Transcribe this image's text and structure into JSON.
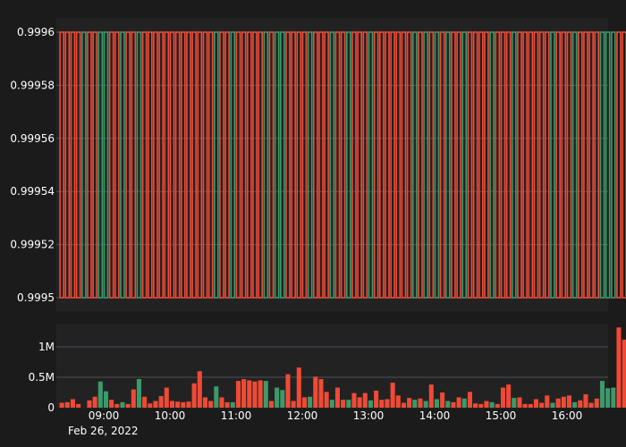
{
  "chart_data": [
    {
      "panel": "price",
      "type": "candlestick",
      "ylim": [
        0.9995,
        0.9996
      ],
      "y_tick_labels": [
        "0.9996",
        "0.99958",
        "0.99956",
        "0.99954",
        "0.99952",
        "0.9995"
      ],
      "y_tick_values": [
        0.9996,
        0.99958,
        0.99956,
        0.99954,
        0.99952,
        0.9995
      ],
      "grid": true,
      "candle_open": 0.9996,
      "candle_close": 0.9995,
      "note_series": "each bar spans the full visible range; direction follows the volume bar color"
    },
    {
      "panel": "volume",
      "type": "bar",
      "y_tick_labels": [
        "1M",
        "0.5M",
        "0"
      ],
      "y_tick_values": [
        1000000,
        500000,
        0
      ],
      "ylim": [
        0,
        1300000
      ],
      "grid": true,
      "x_start": "08:22",
      "x_end": "16:38",
      "x_step_minutes": 5,
      "x_tick_labels": [
        "09:00",
        "10:00",
        "11:00",
        "12:00",
        "13:00",
        "14:00",
        "15:00",
        "16:00"
      ],
      "x_tick_times": [
        "09:00",
        "10:00",
        "11:00",
        "12:00",
        "13:00",
        "14:00",
        "15:00",
        "16:00"
      ],
      "date_label": "Feb 26, 2022",
      "directions": [
        "down",
        "down",
        "down",
        "down",
        "up",
        "down",
        "down",
        "up",
        "up",
        "down",
        "down",
        "up",
        "down",
        "down",
        "up",
        "down",
        "down",
        "down",
        "down",
        "down",
        "down",
        "down",
        "down",
        "down",
        "down",
        "down",
        "down",
        "down",
        "up",
        "down",
        "down",
        "up",
        "down",
        "down",
        "down",
        "down",
        "down",
        "up",
        "down",
        "up",
        "up",
        "down",
        "down",
        "down",
        "down",
        "up",
        "down",
        "down",
        "down",
        "up",
        "down",
        "down",
        "up",
        "down",
        "down",
        "down",
        "up",
        "down",
        "down",
        "down",
        "down",
        "down",
        "down",
        "down",
        "up",
        "down",
        "up",
        "down",
        "up",
        "down",
        "up",
        "down",
        "down",
        "up",
        "down",
        "down",
        "down",
        "down",
        "up",
        "down",
        "down",
        "down",
        "up",
        "down",
        "down",
        "down",
        "down",
        "down",
        "down",
        "up",
        "down",
        "down",
        "down",
        "up",
        "down",
        "down",
        "down",
        "down",
        "up",
        "up",
        "up",
        "down",
        "down",
        "down",
        "down",
        "down",
        "down",
        "down",
        "down",
        "up"
      ],
      "values": [
        80000,
        90000,
        140000,
        60000,
        0,
        120000,
        180000,
        430000,
        270000,
        130000,
        60000,
        90000,
        60000,
        300000,
        470000,
        180000,
        70000,
        110000,
        190000,
        330000,
        110000,
        100000,
        90000,
        100000,
        400000,
        600000,
        170000,
        110000,
        350000,
        170000,
        90000,
        90000,
        440000,
        470000,
        450000,
        430000,
        450000,
        440000,
        110000,
        330000,
        290000,
        550000,
        110000,
        660000,
        170000,
        180000,
        510000,
        470000,
        260000,
        130000,
        330000,
        130000,
        130000,
        240000,
        170000,
        240000,
        120000,
        280000,
        130000,
        140000,
        410000,
        200000,
        80000,
        160000,
        130000,
        150000,
        110000,
        380000,
        140000,
        250000,
        110000,
        90000,
        170000,
        150000,
        260000,
        70000,
        60000,
        110000,
        90000,
        60000,
        330000,
        380000,
        160000,
        170000,
        60000,
        60000,
        140000,
        80000,
        200000,
        80000,
        150000,
        180000,
        200000,
        90000,
        120000,
        220000,
        80000,
        150000,
        440000,
        320000,
        330000,
        1320000,
        1120000
      ]
    }
  ],
  "colors": {
    "page_background": "#1b1b1b",
    "plot_background": "#222222",
    "grid": "#4a5058",
    "axis_text": "#ffffff",
    "up": "#3b9a6a",
    "down": "#f04a36"
  }
}
